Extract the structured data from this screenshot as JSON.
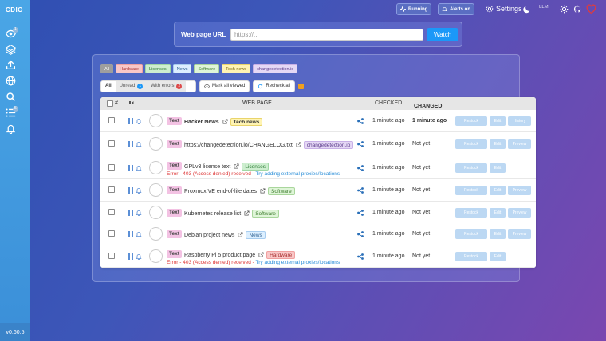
{
  "sidebar": {
    "logo": "CDIO",
    "watch_badge": "1",
    "list_badge": "5",
    "version": "v0.60.5",
    "icons": [
      "eye-icon",
      "layers-icon",
      "import-icon",
      "globe-icon",
      "search-icon",
      "list-icon",
      "bell-icon"
    ]
  },
  "topbar": {
    "running": "Running",
    "alerts": "Alerts on",
    "settings": "Settings",
    "llm": "LLM"
  },
  "url_form": {
    "label": "Web page URL",
    "placeholder": "https://...",
    "watch": "Watch"
  },
  "tags": [
    {
      "label": "All",
      "bg": "#9e9e9e",
      "fg": "#ffffff",
      "bd": "#9e9e9e"
    },
    {
      "label": "Hardware",
      "bg": "#f9c7c7",
      "fg": "#a33",
      "bd": "#f0a0a0"
    },
    {
      "label": "Licenses",
      "bg": "#cdeecf",
      "fg": "#2b7a33",
      "bd": "#9fd8a4"
    },
    {
      "label": "News",
      "bg": "#dcefff",
      "fg": "#2a5d8f",
      "bd": "#a8cdef"
    },
    {
      "label": "Software",
      "bg": "#dff5d8",
      "fg": "#3a7a2a",
      "bd": "#a9d69c"
    },
    {
      "label": "Tech news",
      "bg": "#fff4b3",
      "fg": "#7a6a10",
      "bd": "#e9d46b"
    },
    {
      "label": "changedetection.io",
      "bg": "#e5d8f5",
      "fg": "#5a3a8a",
      "bd": "#c8b0e6"
    }
  ],
  "filters": {
    "all": "All",
    "unread": "Unread",
    "unread_count": "1",
    "errors": "With errors",
    "errors_count": "2",
    "mark_viewed": "Mark all viewed",
    "recheck": "Recheck all"
  },
  "table": {
    "col_page": "WEB PAGE",
    "col_checked": "CHECKED",
    "col_changed": "CHANGED",
    "col_num": "#"
  },
  "buttons": {
    "restock": "Restock",
    "edit": "Edit",
    "history": "History",
    "preview": "Preview"
  },
  "rows": [
    {
      "type": "Text",
      "title": "Hacker News",
      "bold": true,
      "tag": "Tech news",
      "tagbg": "#fff4b3",
      "tagfg": "#333",
      "tagbd": "#e9d46b",
      "checked": "1 minute ago",
      "changed": "1 minute ago",
      "changed_bold": true,
      "error": "",
      "error_link": "",
      "last": "History"
    },
    {
      "type": "Text",
      "title": "https://changedetection.io/CHANGELOG.txt",
      "bold": false,
      "tag": "changedetection.io",
      "tagbg": "#e5d8f5",
      "tagfg": "#5a3a8a",
      "tagbd": "#c8b0e6",
      "checked": "1 minute ago",
      "changed": "Not yet",
      "changed_bold": false,
      "error": "",
      "error_link": "",
      "last": "Preview"
    },
    {
      "type": "Text",
      "title": "GPLv3 license text",
      "bold": false,
      "tag": "Licenses",
      "tagbg": "#cdeecf",
      "tagfg": "#2b7a33",
      "tagbd": "#9fd8a4",
      "checked": "1 minute ago",
      "changed": "Not yet",
      "changed_bold": false,
      "error": "Error - 403 (Access denied) received - ",
      "error_link": "Try adding external proxies/locations",
      "last": ""
    },
    {
      "type": "Text",
      "title": "Proxmox VE end-of-life dates",
      "bold": false,
      "tag": "Software",
      "tagbg": "#dff5d8",
      "tagfg": "#3a7a2a",
      "tagbd": "#a9d69c",
      "checked": "1 minute ago",
      "changed": "Not yet",
      "changed_bold": false,
      "error": "",
      "error_link": "",
      "last": "Preview"
    },
    {
      "type": "Text",
      "title": "Kubernetes release list",
      "bold": false,
      "tag": "Software",
      "tagbg": "#dff5d8",
      "tagfg": "#3a7a2a",
      "tagbd": "#a9d69c",
      "checked": "1 minute ago",
      "changed": "Not yet",
      "changed_bold": false,
      "error": "",
      "error_link": "",
      "last": "Preview"
    },
    {
      "type": "Text",
      "title": "Debian project news",
      "bold": false,
      "tag": "News",
      "tagbg": "#dcefff",
      "tagfg": "#2a5d8f",
      "tagbd": "#a8cdef",
      "checked": "1 minute ago",
      "changed": "Not yet",
      "changed_bold": false,
      "error": "",
      "error_link": "",
      "last": "Preview"
    },
    {
      "type": "Text",
      "title": "Raspberry Pi 5 product page",
      "bold": false,
      "tag": "Hardware",
      "tagbg": "#f9c7c7",
      "tagfg": "#a33",
      "tagbd": "#f0a0a0",
      "checked": "1 minute ago",
      "changed": "Not yet",
      "changed_bold": false,
      "error": "Error - 403 (Access denied) received - ",
      "error_link": "Try adding external proxies/locations",
      "last": ""
    }
  ]
}
